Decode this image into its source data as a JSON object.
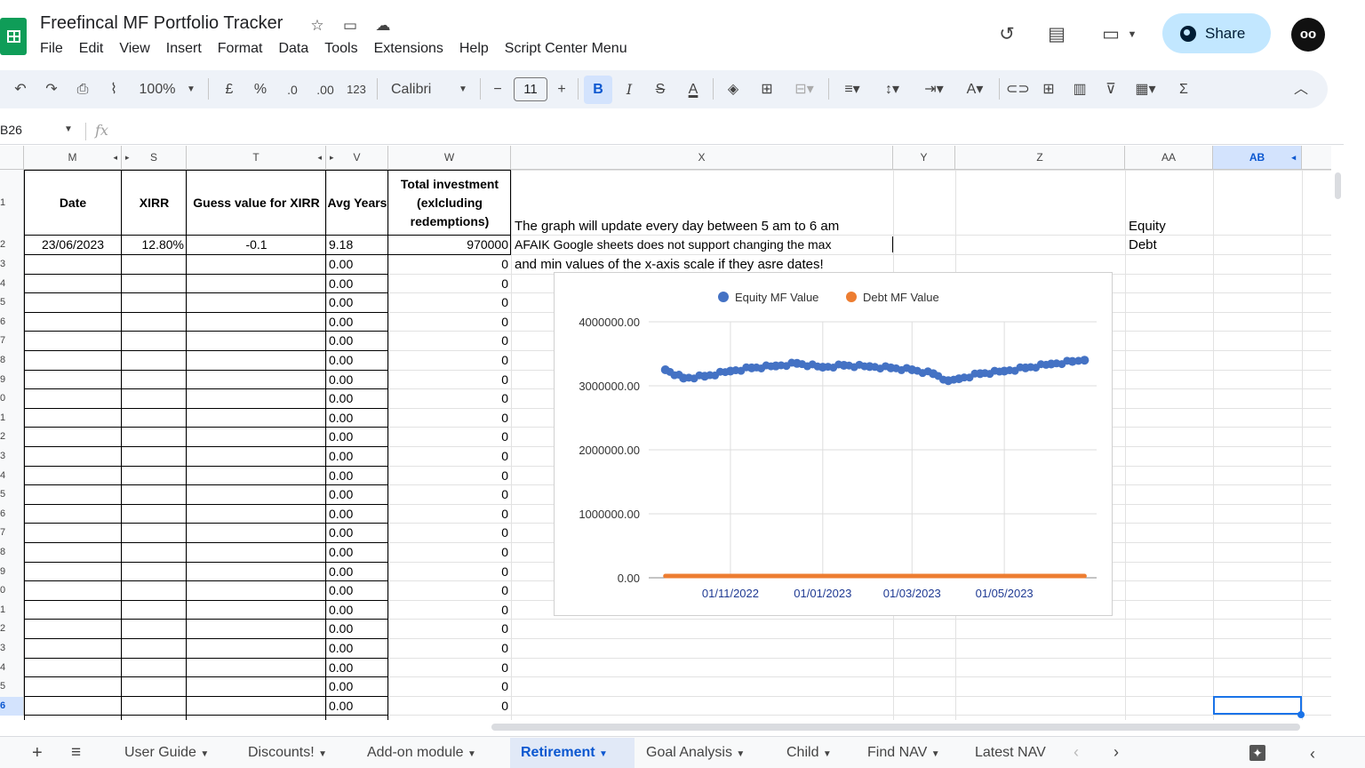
{
  "doc": {
    "title": "Freefincal MF Portfolio Tracker"
  },
  "menu": [
    "File",
    "Edit",
    "View",
    "Insert",
    "Format",
    "Data",
    "Tools",
    "Extensions",
    "Help",
    "Script Center Menu"
  ],
  "header": {
    "share_label": "Share"
  },
  "toolbar": {
    "zoom": "100%",
    "currency": "£",
    "percent": "%",
    "dec_less": ".0",
    "dec_more": ".00",
    "format": "123",
    "font": "Calibri",
    "font_size": "11",
    "bold": "B",
    "italic": "I",
    "sum": "Σ"
  },
  "namebox": "B26",
  "fx_label": "fx",
  "columns": [
    "M",
    "S",
    "T",
    "V",
    "W",
    "X",
    "Y",
    "Z",
    "AA",
    "AB"
  ],
  "rows": [
    "1",
    "2",
    "3",
    "4",
    "5",
    "6",
    "7",
    "8",
    "9",
    "0",
    "1",
    "2",
    "3",
    "4",
    "5",
    "6",
    "7",
    "8",
    "9",
    "0",
    "1",
    "2",
    "3",
    "4",
    "5",
    "6"
  ],
  "headers": {
    "date": "Date",
    "xirr": "XIRR",
    "guess": "Guess value for XIRR",
    "avg": "Avg Years",
    "total_1": "Total investment",
    "total_2": "(exlcluding",
    "total_3": "redemptions)"
  },
  "row2": {
    "date": "23/06/2023",
    "xirr": "12.80%",
    "guess": "-0.1",
    "avg": "9.18",
    "total": "970000"
  },
  "avg_rest": "0.00",
  "total_rest": "0",
  "notes": {
    "line1": "The graph will update every day between 5 am to 6 am",
    "line2": "AFAIK Google sheets does not support changing the max",
    "line3": "and min values of the x-axis scale if they asre dates!"
  },
  "aa": {
    "equity": "Equity",
    "debt": "Debt"
  },
  "chart_data": {
    "type": "scatter",
    "title": "",
    "xlabel": "",
    "ylabel": "",
    "x_ticks": [
      "01/11/2022",
      "01/01/2023",
      "01/03/2023",
      "01/05/2023"
    ],
    "y_ticks": [
      "0.00",
      "1000000.00",
      "2000000.00",
      "3000000.00",
      "4000000.00"
    ],
    "ylim": [
      0,
      4000000
    ],
    "legend": "top",
    "series": [
      {
        "name": "Equity MF Value",
        "color": "#4472c4",
        "x": [
          "2022-09-19",
          "2022-10-01",
          "2022-10-15",
          "2022-11-01",
          "2022-11-15",
          "2022-12-01",
          "2022-12-15",
          "2023-01-01",
          "2023-01-15",
          "2023-02-01",
          "2023-02-15",
          "2023-03-01",
          "2023-03-15",
          "2023-03-25",
          "2023-04-01",
          "2023-04-15",
          "2023-05-01",
          "2023-05-15",
          "2023-06-01",
          "2023-06-15",
          "2023-06-23"
        ],
        "y": [
          3250000,
          3120000,
          3150000,
          3230000,
          3280000,
          3310000,
          3350000,
          3290000,
          3320000,
          3300000,
          3280000,
          3250000,
          3190000,
          3080000,
          3110000,
          3190000,
          3230000,
          3280000,
          3340000,
          3380000,
          3400000
        ]
      },
      {
        "name": "Debt MF Value",
        "color": "#ed7d31",
        "x": [
          "2022-09-19",
          "2023-06-23"
        ],
        "y": [
          0,
          0
        ]
      }
    ]
  },
  "sheets": [
    "User Guide",
    "Discounts!",
    "Add-on module",
    "Retirement",
    "Goal Analysis",
    "Child",
    "Find NAV",
    "Latest NAV"
  ],
  "active_sheet": "Retirement"
}
